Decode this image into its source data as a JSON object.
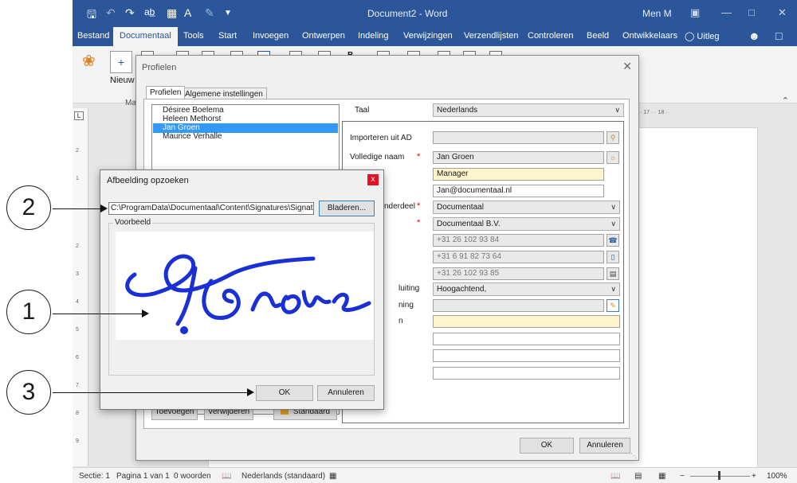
{
  "word": {
    "title": "Document2 - Word",
    "user": "Men M",
    "tabs": [
      "Bestand",
      "Documentaal",
      "Tools",
      "Start",
      "Invoegen",
      "Ontwerpen",
      "Indeling",
      "Verwijzingen",
      "Verzendlijsten",
      "Controleren",
      "Beeld",
      "Ontwikkelaars",
      "Uitleg"
    ],
    "ribbon_new": "Nieuw",
    "ribbon_group": "Ma",
    "ruler_marks": "· 17 · · 18 ·",
    "ruler_corner": "L"
  },
  "statusbar": {
    "section": "Sectie: 1",
    "page": "Pagina 1 van 1",
    "words": "0 woorden",
    "language": "Nederlands (standaard)",
    "zoom": "100%"
  },
  "profielen": {
    "title": "Profielen",
    "tabs": [
      "Profielen",
      "Algemene instellingen"
    ],
    "names": [
      "Désiree Boelema",
      "Heleen Methorst",
      "Jan Groen",
      "Maurice Verhalle"
    ],
    "selected_index": 2,
    "taal_label": "Taal",
    "taal_value": "Nederlands",
    "labels": {
      "importeren": "Importeren uit AD",
      "volledige_naam": "Volledige naam",
      "onderdeel": "nderdeel",
      "afsluiting": "luiting",
      "handtekening": "ning",
      "extra": "n"
    },
    "fields": {
      "naam": "Jan Groen",
      "functie": "Manager",
      "email": "Jan@documentaal.nl",
      "afdeling": "Documentaal",
      "bedrijf": "Documentaal B.V.",
      "telefoon": "+31 26 102 93 84",
      "mobiel": "+31 6 91 82 73 64",
      "fax": "+31 26 102 93 85",
      "afsluiting": "Hoogachtend,"
    },
    "buttons": {
      "toevoegen": "Toevoegen",
      "verwijderen": "Verwijderen",
      "standaard": "Standaard",
      "ok": "OK",
      "annuleren": "Annuleren"
    }
  },
  "afbeelding": {
    "title": "Afbeelding opzoeken",
    "close": "x",
    "path": "C:\\ProgramData\\Documentaal\\Content\\Signatures\\Signature Jan G",
    "bladeren": "Bladeren...",
    "voorbeeld": "Voorbeeld",
    "ok": "OK",
    "annuleren": "Annuleren"
  },
  "callouts": [
    "2",
    "1",
    "3"
  ],
  "colors": {
    "word_blue": "#2b579a",
    "selection": "#3399ff",
    "signature_ink": "#1a2fd6",
    "required": "#dd0000",
    "close_red": "#e81123"
  }
}
